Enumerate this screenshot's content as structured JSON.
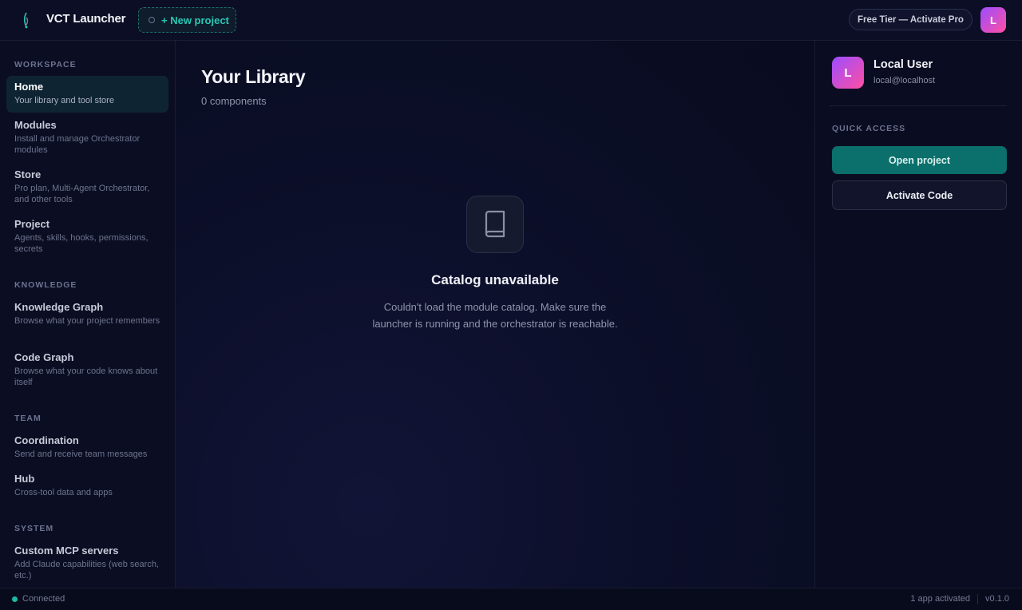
{
  "header": {
    "app_title": "VCT Launcher",
    "new_project_label": "+ New project",
    "tier_label": "Free Tier — Activate Pro",
    "avatar_initial": "L"
  },
  "sidebar": {
    "sections": [
      {
        "title": "WORKSPACE",
        "items": [
          {
            "label": "Home",
            "desc": "Your library and tool store",
            "active": true
          },
          {
            "label": "Modules",
            "desc": "Install and manage Orchestrator modules"
          },
          {
            "label": "Store",
            "desc": "Pro plan, Multi-Agent Orchestrator, and other tools"
          },
          {
            "label": "Project",
            "desc": "Agents, skills, hooks, permissions, secrets"
          }
        ]
      },
      {
        "title": "KNOWLEDGE",
        "items": [
          {
            "label": "Knowledge Graph",
            "desc": "Browse what your project remembers"
          },
          {
            "label": "Code Graph",
            "desc": "Browse what your code knows about itself"
          }
        ]
      },
      {
        "title": "TEAM",
        "items": [
          {
            "label": "Coordination",
            "desc": "Send and receive team messages"
          },
          {
            "label": "Hub",
            "desc": "Cross-tool data and apps"
          }
        ]
      },
      {
        "title": "SYSTEM",
        "items": [
          {
            "label": "Custom MCP servers",
            "desc": "Add Claude capabilities (web search, etc.)"
          }
        ]
      }
    ]
  },
  "main": {
    "title": "Your Library",
    "subtitle": "0 components",
    "empty_state": {
      "icon": "book-icon",
      "title": "Catalog unavailable",
      "message": "Couldn't load the module catalog. Make sure the launcher is running and the orchestrator is reachable."
    }
  },
  "right_panel": {
    "user": {
      "initial": "L",
      "name": "Local User",
      "email": "local@localhost"
    },
    "quick_access_title": "QUICK ACCESS",
    "open_project_label": "Open project",
    "activate_code_label": "Activate Code"
  },
  "status_bar": {
    "connection": "Connected",
    "apps": "1 app activated",
    "version": "v0.1.0"
  },
  "colors": {
    "accent": "#0b6f6c",
    "accent_text": "#2bc7b5",
    "avatar_gradient_start": "#9b4dff",
    "avatar_gradient_end": "#ff4fa3",
    "status_ok": "#1fb8a4"
  }
}
